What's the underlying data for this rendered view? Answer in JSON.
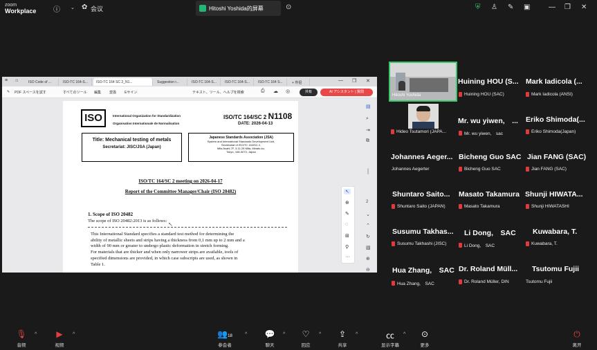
{
  "app": {
    "brand_small": "zoom",
    "brand_big": "Workplace",
    "meeting_title": "会议",
    "share_label": "Hitoshi Yoshida的屏幕"
  },
  "browser": {
    "tabs": [
      "ISO Code of ...",
      "ISO-TC 164-S...",
      "ISO-TC 164 SC 2_N1...",
      "Suggestion r...",
      "ISO-TC 164-S...",
      "ISO-TC 164-S...",
      "ISO-TC 164 S...",
      "+ 件招"
    ],
    "toolbar": {
      "pdf_save": "PDF スペースを試す",
      "all_tools": "すべてのツール",
      "edit": "編集",
      "convert": "変換",
      "esign": "Eサイン",
      "search": "テキスト、ツール、ヘルプを検索",
      "share": "共有",
      "ai": "AI アシスタント | 質問"
    }
  },
  "document": {
    "org1": "International Organization for Standardization",
    "org2": "Organisation Internationale de Normalisation",
    "logo": "ISO",
    "ref_prefix": "ISO/TC 164/SC 2",
    "ref_num": "N1108",
    "date": "DATE: 2026-04-13",
    "title": "Title: Mechanical testing of metals",
    "secretariat": "Secretariat: JISC/JSA (Japan)",
    "jsa_name": "Japanese Standards Association (JSA)",
    "jsa_lines": [
      "System and International Standards Development Unit,",
      "Secretariat of ISO/TC 164/SC 2,",
      "Mita Asahi,7F, 3-11-28 Mita, Minato-ku,",
      "Tokyo, 108-0073, Japan"
    ],
    "meeting": "ISO/TC 164/SC 2 meeting on 2026-04-17",
    "report": "Report of the Committee Manager/Chair (ISO 20482)",
    "scope_head": "1.  Scope of ISO 20482",
    "scope_text": "The scope of ISO 20482:2013 is as follows:",
    "para": [
      "This International Standard specifies a standard test method for determining the",
      "ability of metallic sheets and strips having a thickness from 0,1 mm up to 2 mm and a",
      "width of 90 mm or greater to undergo plastic deformation in stretch forming.",
      "For materials that are thicker and when only narrower strips are available, tools of",
      "specified dimensions are provided, in which case subscripts are used, as shown in",
      "Table 1."
    ],
    "page_num": "2"
  },
  "participants": {
    "hitoshi_label": "Hitoshi Yoshida",
    "rows": [
      [
        {
          "big": "Huining HOU (S...",
          "small": "Huining HOU (SAC)"
        },
        {
          "big": "Mark Iadicola (...",
          "small": "Mark Iadicola (ANSI)"
        }
      ],
      [
        {
          "big": "Mr. wu yiwen,　...",
          "small": "Mr. wu yiwen,　sac"
        },
        {
          "big": "Eriko Shimoda(...",
          "small": "Eriko Shimoda(Japan)"
        }
      ],
      [
        {
          "big": "Johannes Aeger...",
          "small": "Johannes Aegerter",
          "muted": false
        },
        {
          "big": "Bicheng Guo SAC",
          "small": "Bicheng Guo SAC"
        },
        {
          "big": "Jian FANG (SAC)",
          "small": "Jian FANG (SAC)"
        }
      ],
      [
        {
          "big": "Shuntaro Saito...",
          "small": "Shuntaro Saito (JAPAN)"
        },
        {
          "big": "Masato Takamura",
          "small": "Masato Takamura"
        },
        {
          "big": "Shunji HIWATA...",
          "small": "Shunji HIWATASHI"
        }
      ],
      [
        {
          "big": "Susumu Takhas...",
          "small": "Susumu Takhashi (JISC)"
        },
        {
          "big": "Li Dong,　SAC",
          "small": "Li Dong,　SAC"
        },
        {
          "big": "Kuwabara, T.",
          "small": "Kuwabara, T."
        }
      ],
      [
        {
          "big": "Hua Zhang,　SAC",
          "small": "Hua Zhang,　SAC"
        },
        {
          "big": "Dr. Roland Müll...",
          "small": "Dr. Roland Müller, DIN"
        },
        {
          "big": "Tsutomu Fujii",
          "small": "Tsutomu Fujii",
          "muted": false
        }
      ]
    ],
    "tsutomori_small": "Hideo Tsutamori (JAPA..."
  },
  "bottom": {
    "audio": "音频",
    "video": "视频",
    "participants": "参会者",
    "participants_count": "18",
    "chat": "聊天",
    "react": "回应",
    "share": "共享",
    "captions": "显示字幕",
    "more": "更多",
    "leave": "离开"
  }
}
